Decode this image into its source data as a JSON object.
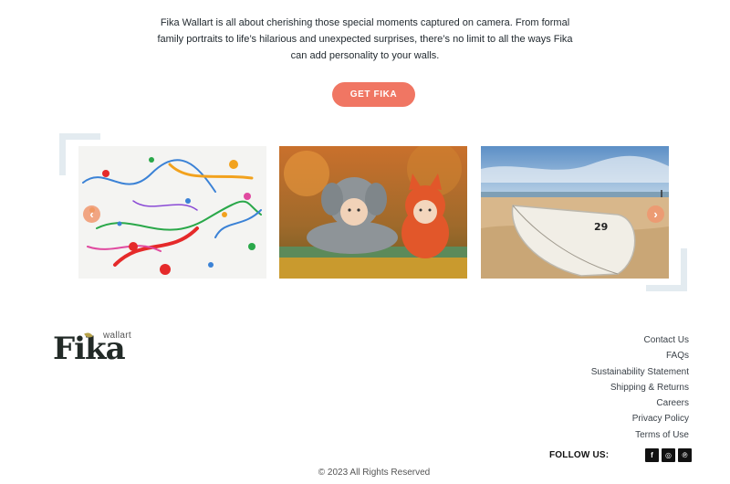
{
  "intro": {
    "text": "Fika Wallart is all about cherishing those special moments captured on camera. From formal family portraits to life’s hilarious and unexpected surprises, there’s no limit to all the ways Fika can add personality to your walls."
  },
  "cta": {
    "label": "GET FIKA"
  },
  "carousel": {
    "prev_icon": "chevron-left-icon",
    "next_icon": "chevron-right-icon",
    "slides": [
      {
        "subject": "paint-splatter-art"
      },
      {
        "subject": "babies-in-animal-costumes"
      },
      {
        "subject": "boat-on-beach",
        "boat_number": "29"
      }
    ]
  },
  "footer": {
    "logo": {
      "word": "Fika",
      "small": "wallart"
    },
    "links": [
      "Contact Us",
      "FAQs",
      "Sustainability Statement",
      "Shipping & Returns",
      "Careers",
      "Privacy Policy",
      "Terms of Use"
    ],
    "follow_label": "FOLLOW US:",
    "social": [
      {
        "icon": "facebook-icon",
        "glyph": "f"
      },
      {
        "icon": "instagram-icon",
        "glyph": "◎"
      },
      {
        "icon": "pinterest-icon",
        "glyph": "℗"
      }
    ],
    "copyright": "© 2023 All Rights Reserved"
  },
  "colors": {
    "accent": "#f07663",
    "frame": "#e3ebf0",
    "text": "#222a30"
  }
}
